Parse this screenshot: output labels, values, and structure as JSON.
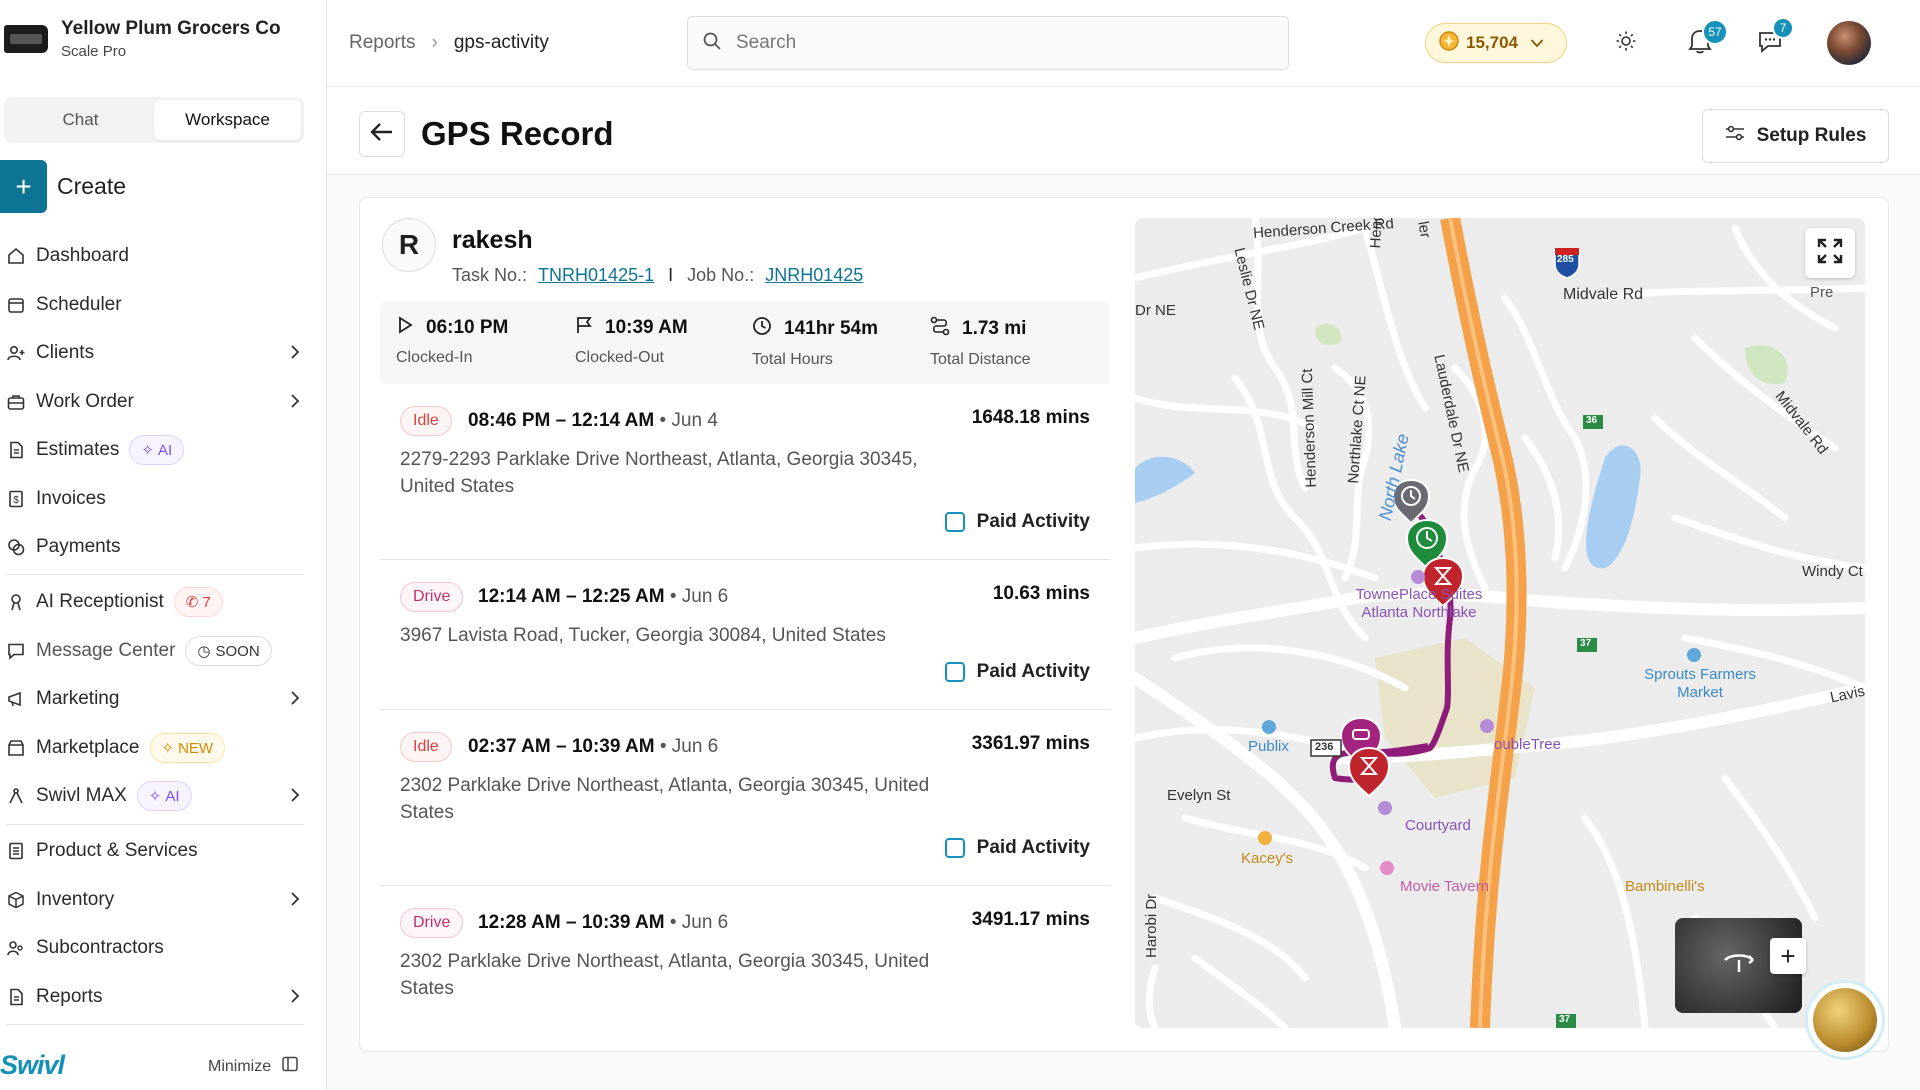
{
  "brand": {
    "name": "Yellow Plum Grocers Co",
    "plan": "Scale Pro"
  },
  "mode_switch": {
    "chat": "Chat",
    "workspace": "Workspace"
  },
  "create_label": "Create",
  "nav": {
    "dashboard": "Dashboard",
    "scheduler": "Scheduler",
    "clients": "Clients",
    "work_order": "Work Order",
    "estimates": "Estimates",
    "estimates_badge": "AI",
    "invoices": "Invoices",
    "payments": "Payments",
    "ai_receptionist": "AI Receptionist",
    "ai_receptionist_badge": "7",
    "message_center": "Message Center",
    "message_center_badge": "SOON",
    "marketing": "Marketing",
    "marketplace": "Marketplace",
    "marketplace_badge": "NEW",
    "swivl_max": "Swivl MAX",
    "swivl_max_badge": "AI",
    "products": "Product & Services",
    "inventory": "Inventory",
    "subcontractors": "Subcontractors",
    "reports": "Reports"
  },
  "footer": {
    "logo": "Swivl",
    "minimize": "Minimize"
  },
  "breadcrumb": {
    "parent": "Reports",
    "current": "gps-activity"
  },
  "search": {
    "placeholder": "Search"
  },
  "credits": "15,704",
  "notifications_count": "57",
  "messages_count": "7",
  "page": {
    "title": "GPS Record",
    "setup_rules": "Setup Rules"
  },
  "record": {
    "initial": "R",
    "name": "rakesh",
    "task_label": "Task No.:",
    "task_no": "TNRH01425-1",
    "separator": "I",
    "job_label": "Job No.:",
    "job_no": "JNRH01425"
  },
  "stats": [
    {
      "value": "06:10 PM",
      "label": "Clocked-In"
    },
    {
      "value": "10:39 AM",
      "label": "Clocked-Out"
    },
    {
      "value": "141hr 54m",
      "label": "Total Hours"
    },
    {
      "value": "1.73 mi",
      "label": "Total Distance"
    }
  ],
  "activities": [
    {
      "type": "Idle",
      "time": "08:46 PM – 12:14 AM",
      "date": "• Jun 4",
      "mins": "1648.18 mins",
      "address": "2279-2293 Parklake Drive Northeast, Atlanta, Georgia 30345, United States",
      "paid_label": "Paid Activity"
    },
    {
      "type": "Drive",
      "time": "12:14 AM – 12:25 AM",
      "date": "• Jun 6",
      "mins": "10.63 mins",
      "address": "3967 Lavista Road, Tucker, Georgia 30084, United States",
      "paid_label": "Paid Activity"
    },
    {
      "type": "Idle",
      "time": "02:37 AM – 10:39 AM",
      "date": "• Jun 6",
      "mins": "3361.97 mins",
      "address": "2302 Parklake Drive Northeast, Atlanta, Georgia 30345, United States",
      "paid_label": "Paid Activity"
    },
    {
      "type": "Drive",
      "time": "12:28 AM – 10:39 AM",
      "date": "• Jun 6",
      "mins": "3491.17 mins",
      "address": "2302 Parklake Drive Northeast, Atlanta, Georgia 30345, United States"
    }
  ],
  "map": {
    "labels": {
      "henderson_creek": "Henderson Creek Rd",
      "midvale": "Midvale Rd",
      "midvale_diag": "Midvale Rd",
      "dr_ne": "Dr NE",
      "leslie": "Leslie Dr NE",
      "lauderdale": "Lauderdale Dr NE",
      "north_lake": "North Lake",
      "henderson_mill": "Henderson Mill Ct",
      "northlake_ct": "Northlake Ct NE",
      "windy": "Windy Ct",
      "towneplace": "TownePlace Suites Atlanta Northlake",
      "sprouts": "Sprouts Farmers Market",
      "publix": "Publix",
      "doubletree": "oubleTree",
      "evelyn": "Evelyn St",
      "courtyard": "Courtyard",
      "kaceys": "Kacey's",
      "movie": "Movie Tavern",
      "harobi": "Harobi Dr",
      "lavis": "Lavis",
      "pre": "Pre",
      "bambinelli": "Bambinelli's",
      "hendersc": "Henders",
      "ler": "ler",
      "rt285": "285",
      "rt36": "36",
      "rt37": "37",
      "rt236": "236",
      "rt37b": "37"
    },
    "route_color": "#8e1d7a",
    "highway_color": "#f5a14a"
  }
}
